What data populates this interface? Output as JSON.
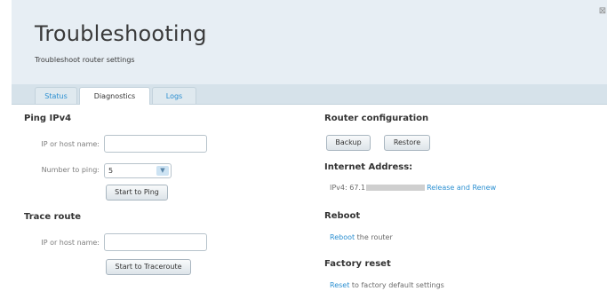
{
  "header": {
    "title": "Troubleshooting",
    "subtitle": "Troubleshoot router settings",
    "close_glyph": "⊠"
  },
  "tabs": [
    {
      "label": "Status",
      "active": false
    },
    {
      "label": "Diagnostics",
      "active": true
    },
    {
      "label": "Logs",
      "active": false
    }
  ],
  "ping": {
    "title": "Ping IPv4",
    "host_label": "IP or host name:",
    "host_value": "",
    "count_label": "Number to ping:",
    "count_value": "5",
    "start_button": "Start to Ping"
  },
  "trace": {
    "title": "Trace route",
    "host_label": "IP or host name:",
    "host_value": "",
    "start_button": "Start to Traceroute"
  },
  "router_config": {
    "title": "Router configuration",
    "backup_button": "Backup",
    "restore_button": "Restore"
  },
  "internet": {
    "title": "Internet Address:",
    "ipv4_prefix": "IPv4: 67.1",
    "release_link": "Release and Renew"
  },
  "reboot": {
    "title": "Reboot",
    "link": "Reboot",
    "text": " the router"
  },
  "factory": {
    "title": "Factory reset",
    "link": "Reset",
    "text": " to factory default settings"
  },
  "colors": {
    "header_bg": "#e7eef4",
    "tabbar_bg": "#d6e2ea",
    "link": "#2b8fd1",
    "title_text": "#3a3a3a"
  },
  "icons": {
    "close": "close-icon",
    "dropdown": "chevron-down-icon"
  }
}
